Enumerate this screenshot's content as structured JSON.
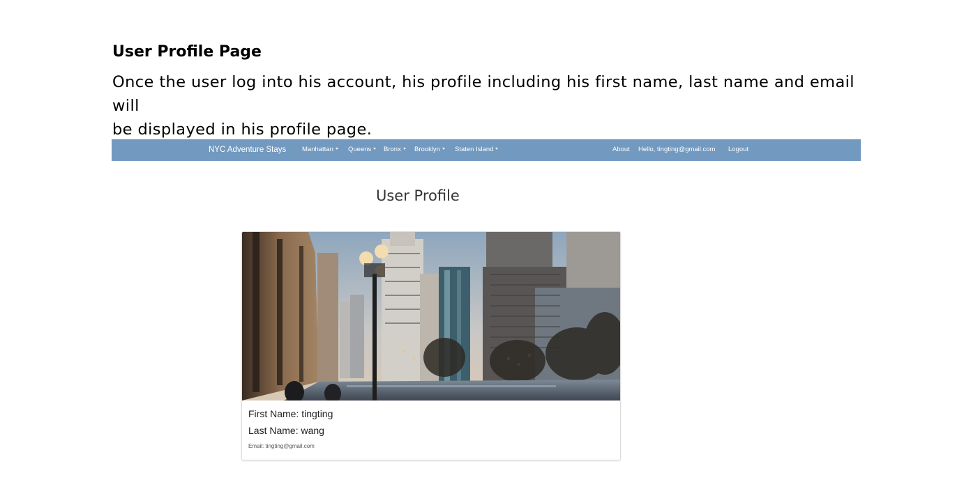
{
  "document": {
    "heading": "User Profile Page",
    "paragraph_line1": "Once the user log into his account, his profile including his first name, last name and email will",
    "paragraph_line2": "be displayed in his profile page."
  },
  "navbar": {
    "brand": "NYC Adventure Stays",
    "menus": [
      "Manhattan",
      "Queens",
      "Bronx",
      "Brooklyn",
      "Staten Island"
    ],
    "about": "About",
    "greeting": "Hello, tingting@gmail.com",
    "logout": "Logout",
    "color": "#7299c0"
  },
  "profile": {
    "title": "User Profile",
    "first_name": "First Name: tingting",
    "last_name": "Last Name: wang",
    "email": "Email: tingting@gmail.com"
  }
}
